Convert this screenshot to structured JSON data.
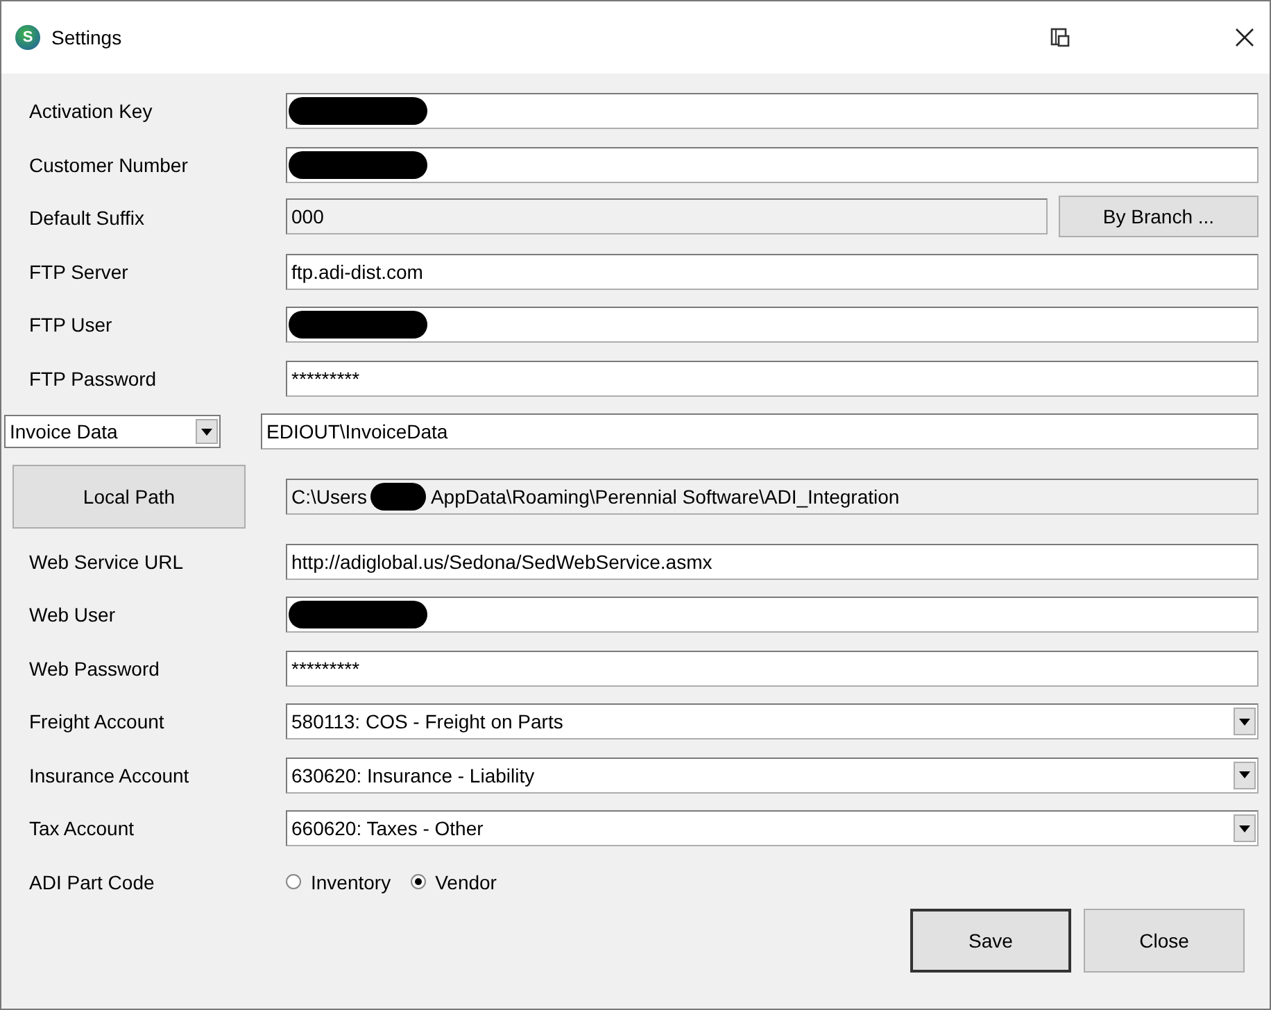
{
  "window": {
    "title": "Settings",
    "logo_letter": "S"
  },
  "fields": [
    {
      "kind": "text",
      "label": "Activation Key",
      "redacted": true
    },
    {
      "kind": "text",
      "label": "Customer Number",
      "redacted": true
    },
    {
      "kind": "readonly",
      "label": "Default Suffix",
      "value": "000",
      "button": "By Branch ..."
    },
    {
      "kind": "text",
      "label": "FTP Server",
      "value": "ftp.adi-dist.com"
    },
    {
      "kind": "text",
      "label": "FTP User",
      "redacted": true
    },
    {
      "kind": "text",
      "label": "FTP Password",
      "value": "*********"
    },
    {
      "kind": "select-field",
      "selector": "Invoice Data",
      "value": "EDIOUT\\InvoiceData"
    },
    {
      "kind": "path",
      "button": "Local Path",
      "value": "C:\\Users",
      "value_after": "AppData\\Roaming\\Perennial Software\\ADI_Integration",
      "redacted": true
    },
    {
      "kind": "text",
      "label": "Web Service URL",
      "value": "http://adiglobal.us/Sedona/SedWebService.asmx"
    },
    {
      "kind": "text",
      "label": "Web User",
      "redacted": true
    },
    {
      "kind": "text",
      "label": "Web Password",
      "value": "*********"
    },
    {
      "kind": "dropdown",
      "label": "Freight Account",
      "value": "580113: COS - Freight on Parts"
    },
    {
      "kind": "dropdown",
      "label": "Insurance Account",
      "value": "630620: Insurance - Liability"
    },
    {
      "kind": "dropdown",
      "label": "Tax Account",
      "value": "660620: Taxes - Other"
    },
    {
      "kind": "radio",
      "label": "ADI Part Code",
      "options": [
        {
          "label": "Inventory",
          "selected": false
        },
        {
          "label": "Vendor",
          "selected": true
        }
      ]
    }
  ],
  "buttons": [
    {
      "label": "Save",
      "default": true
    },
    {
      "label": "Close",
      "default": false
    }
  ]
}
